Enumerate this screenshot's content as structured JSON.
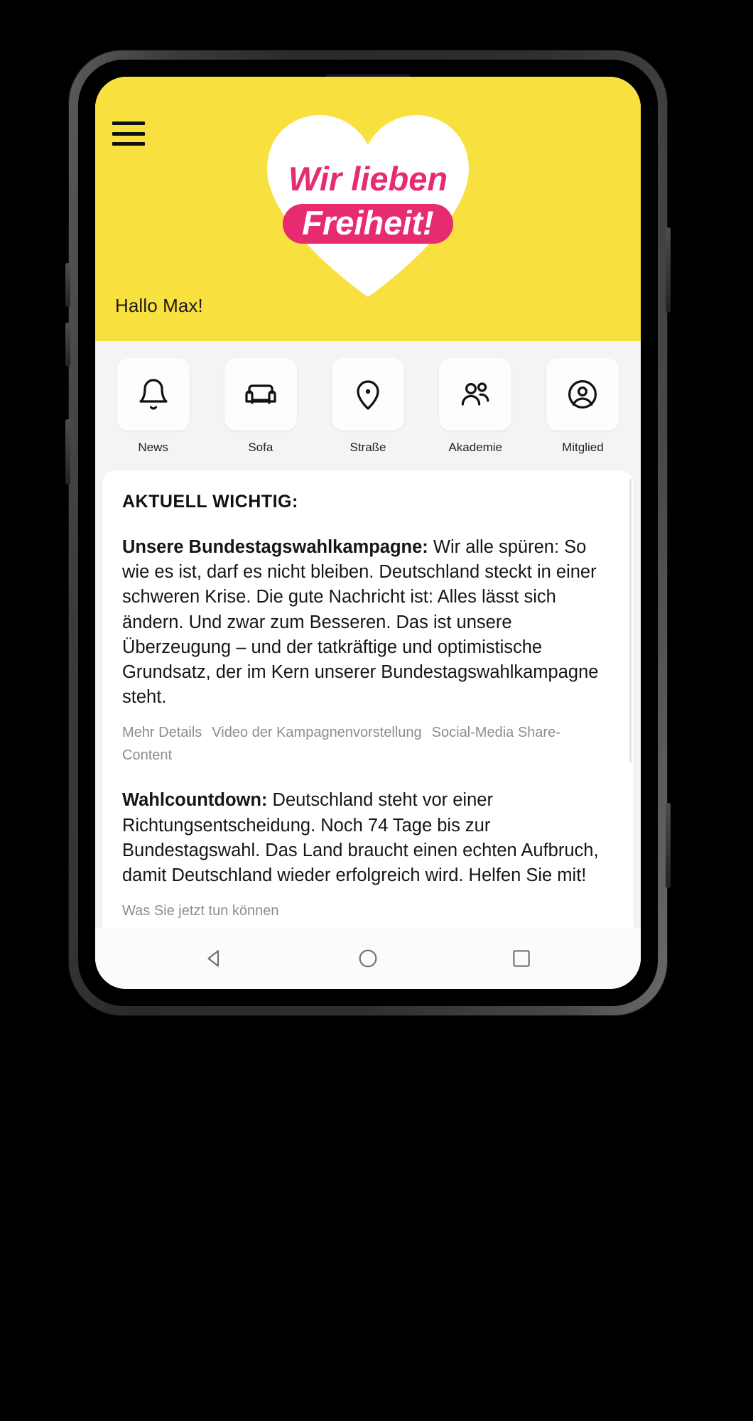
{
  "theme": {
    "brand_yellow": "#F8E03E",
    "brand_pink": "#E62B70",
    "text_dark": "#161616",
    "link_gray": "#8D8D8D",
    "card_white": "#FFFFFF",
    "page_gray": "#F4F4F4"
  },
  "header": {
    "menu_icon": "hamburger-menu-icon",
    "logo": {
      "shape": "heart-icon",
      "line1": "Wir lieben",
      "line2": "Freiheit!"
    },
    "greeting": "Hallo Max!"
  },
  "quicknav": {
    "items": [
      {
        "label": "News",
        "icon": "bell-icon"
      },
      {
        "label": "Sofa",
        "icon": "sofa-icon"
      },
      {
        "label": "Straße",
        "icon": "map-pin-icon"
      },
      {
        "label": "Akademie",
        "icon": "people-icon"
      },
      {
        "label": "Mitglied",
        "icon": "user-circle-icon"
      }
    ]
  },
  "card": {
    "title": "AKTUELL WICHTIG:",
    "sections": [
      {
        "lead": "Unsere Bundestagswahlkampagne:",
        "body": " Wir alle spüren: So wie es ist, darf es nicht bleiben. Deutschland steckt in einer schweren Krise. Die gute Nachricht ist: Alles lässt sich ändern. Und zwar zum Besseren. Das ist unsere Überzeugung – und der tatkräftige und optimistische Grundsatz, der im Kern unserer Bundestagswahlkampagne steht.",
        "links": [
          "Mehr Details",
          "Video der Kampagnenvorstellung",
          "Social-Media Share-Content"
        ]
      },
      {
        "lead": "Wahlcountdown:",
        "body": " Deutschland steht vor einer Richtungsentscheidung. Noch 74 Tage bis zur Bundestagswahl. Das Land braucht einen echten Aufbruch, damit Deutschland wieder erfolgreich wird. Helfen Sie mit!",
        "links": [
          "Was Sie jetzt tun können"
        ]
      }
    ]
  },
  "androidbar": {
    "back": "back-triangle-icon",
    "home": "home-circle-icon",
    "recents": "recents-square-icon"
  }
}
